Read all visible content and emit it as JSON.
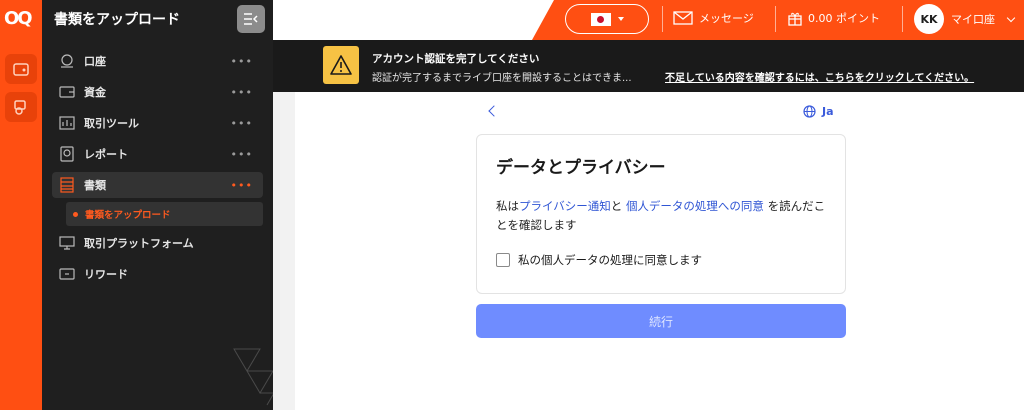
{
  "brand": {
    "logo_text": "OQ"
  },
  "sidebar": {
    "title": "書類をアップロード",
    "items": [
      {
        "label": "口座",
        "icon": "account-icon",
        "more": "•••"
      },
      {
        "label": "資金",
        "icon": "wallet-icon",
        "more": "•••"
      },
      {
        "label": "取引ツール",
        "icon": "trading-tools-icon",
        "more": "•••"
      },
      {
        "label": "レポート",
        "icon": "report-icon",
        "more": "•••"
      },
      {
        "label": "書類",
        "icon": "documents-icon",
        "more": "•••",
        "active": true
      },
      {
        "label": "取引プラットフォーム",
        "icon": "platform-icon"
      },
      {
        "label": "リワード",
        "icon": "rewards-icon"
      }
    ],
    "sub_item": {
      "label": "書類をアップロード"
    }
  },
  "header": {
    "language_flag": "japan-flag-icon",
    "messages_label": "メッセージ",
    "points_label": "0.00 ポイント",
    "avatar_initials": "KK",
    "account_label": "マイ口座"
  },
  "banner": {
    "title": "アカウント認証を完了してください",
    "text": "認証が完了するまでライブ口座を開設することはできま...",
    "link": "不足している内容を確認するには、こちらをクリックしてください。"
  },
  "main": {
    "language_label": "Ja",
    "card": {
      "title": "データとプライバシー",
      "text_prefix": "私は",
      "privacy_link": "プライバシー通知",
      "text_and": "と",
      "consent_link": "個人データの処理への同意",
      "text_suffix": "を読んだことを確認します",
      "checkbox_label": "私の個人データの処理に同意します"
    },
    "continue_label": "続行"
  },
  "colors": {
    "brand_orange": "#ff4f12",
    "sidebar_bg": "#1f1f1f",
    "link_blue": "#2f55d4",
    "button_disabled": "#6f8cff",
    "warning_yellow": "#f6c244"
  }
}
